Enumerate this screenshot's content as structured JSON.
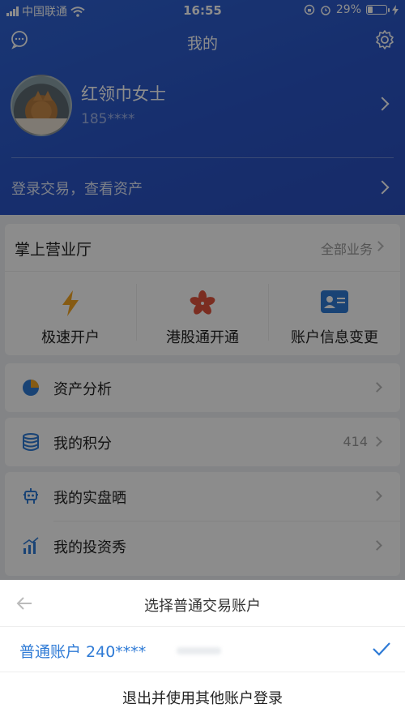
{
  "status_bar": {
    "carrier": "中国联通",
    "time": "16:55",
    "battery_text": "29%",
    "battery_level": 0.29
  },
  "nav": {
    "title": "我的",
    "left_icon": "message-icon",
    "right_icon": "gear-icon"
  },
  "profile": {
    "name": "红领巾女士",
    "phone": "185****"
  },
  "login_prompt": "登录交易，查看资产",
  "service_hall": {
    "title": "掌上营业厅",
    "all_link": "全部业务",
    "services": [
      {
        "label": "极速开户",
        "icon": "lightning-icon",
        "color": "#f5a623"
      },
      {
        "label": "港股通开通",
        "icon": "bauhinia-icon",
        "color": "#e0533c"
      },
      {
        "label": "账户信息变更",
        "icon": "id-card-icon",
        "color": "#2f7bd6"
      }
    ]
  },
  "menu": {
    "asset_analysis": "资产分析",
    "points": {
      "label": "我的积分",
      "count": "414"
    },
    "real_trading": "我的实盘晒",
    "invest_show": "我的投资秀"
  },
  "sheet": {
    "title": "选择普通交易账户",
    "account": "普通账户 240****",
    "logout": "退出并使用其他账户登录"
  },
  "colors": {
    "header_blue": "#2a55c7",
    "accent_blue": "#2f7bd6",
    "lightning_orange": "#f5a623",
    "bauhinia_red": "#e0533c"
  }
}
